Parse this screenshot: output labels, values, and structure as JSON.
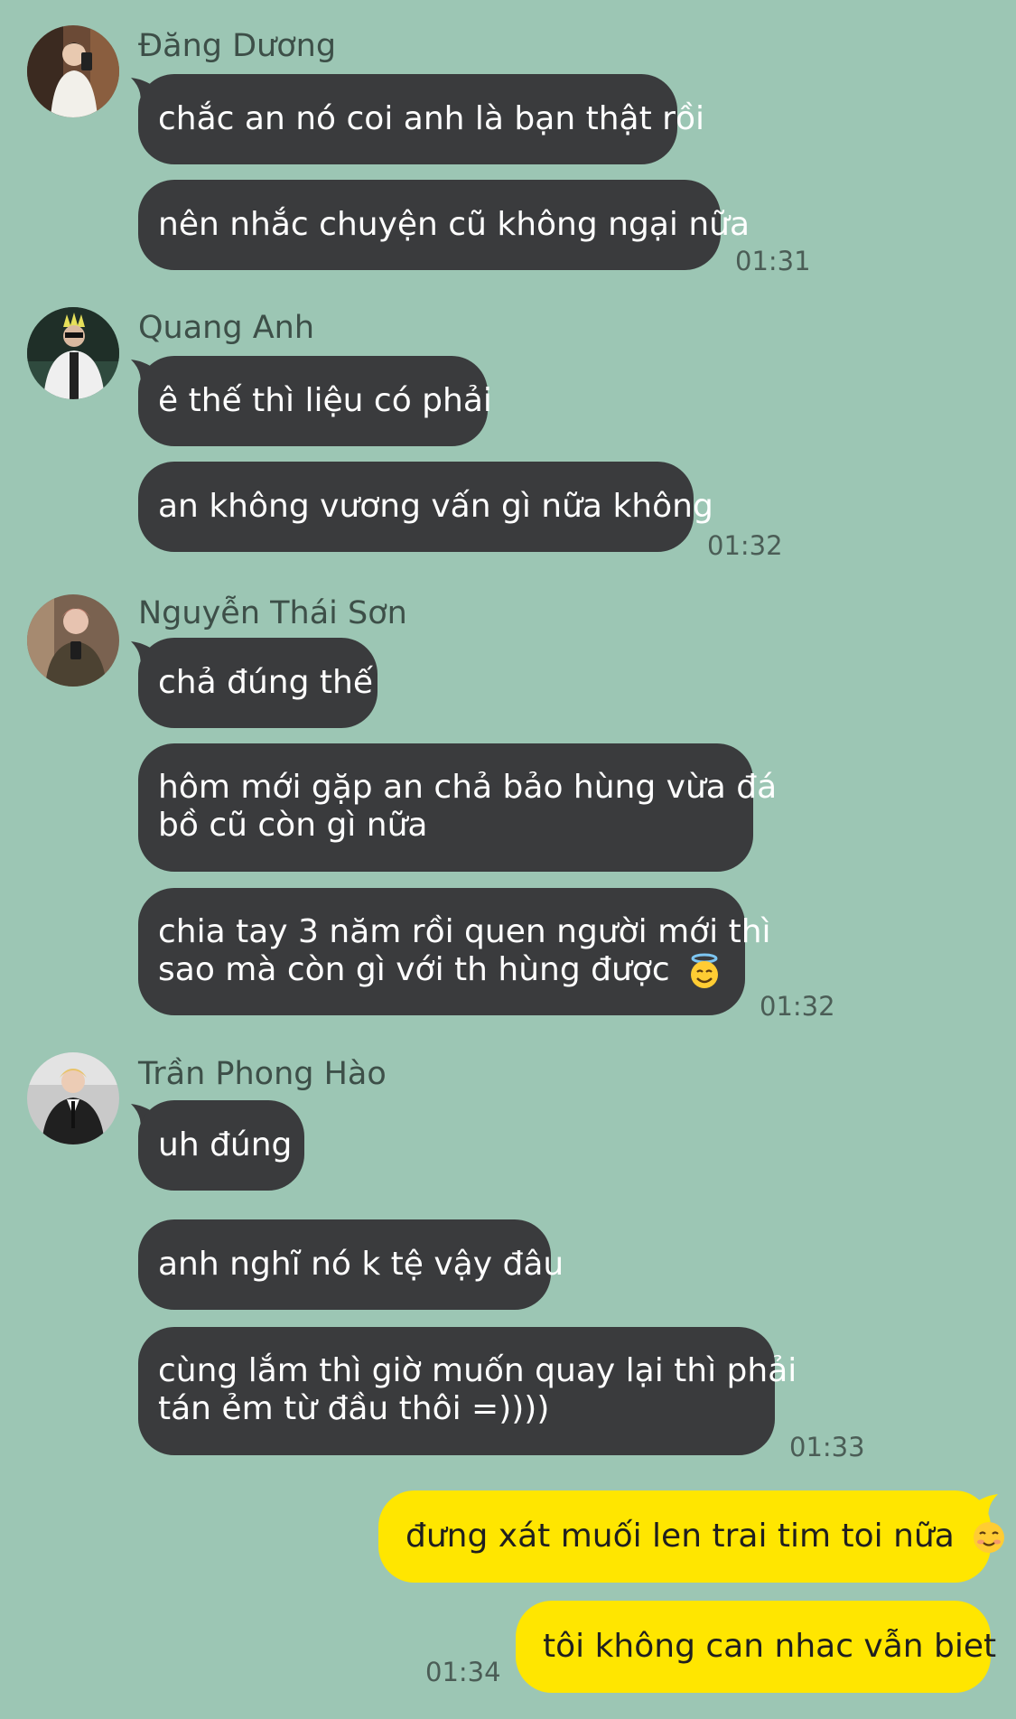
{
  "colors": {
    "background": "#9cc6b4",
    "incoming_bubble": "#3a3b3d",
    "outgoing_bubble": "#ffe600"
  },
  "messages": [
    {
      "sender": "Đăng Dương",
      "lines": [
        "chắc an nó coi anh là bạn thật rồi",
        "nên nhắc chuyện cũ không ngại nữa"
      ],
      "time": "01:31"
    },
    {
      "sender": "Quang Anh",
      "lines": [
        "ê thế thì liệu có phải",
        "an không vương vấn gì nữa không"
      ],
      "time": "01:32"
    },
    {
      "sender": "Nguyễn Thái Sơn",
      "lines": [
        "chả đúng thế",
        "hôm mới gặp an chả bảo hùng vừa đá",
        "bồ cũ còn gì nữa",
        "chia tay 3 năm rồi quen người mới thì",
        "sao mà còn gì với th hùng được"
      ],
      "time": "01:32"
    },
    {
      "sender": "Trần Phong Hào",
      "lines": [
        "uh đúng",
        "anh nghĩ nó k tệ vậy đâu",
        "cùng lắm thì giờ muốn quay lại thì phải",
        "tán ẻm từ đầu thôi =))))"
      ],
      "time": "01:33"
    }
  ],
  "outgoing": {
    "lines": [
      "đưng xát muối len trai tim toi nữa",
      "tôi không can nhac vẫn biet"
    ],
    "time": "01:34"
  },
  "icons": {
    "halo_emoji": "smiling-face-with-halo-icon",
    "blush_emoji": "smiling-face-icon"
  }
}
